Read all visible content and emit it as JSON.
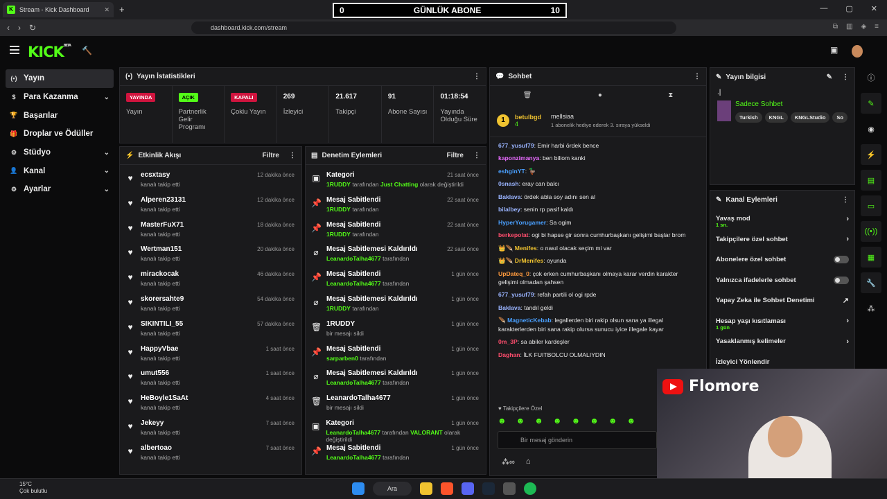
{
  "browser": {
    "tab_title": "Stream - Kick Dashboard",
    "url": "dashboard.kick.com/stream"
  },
  "overlay": {
    "left": "0",
    "title": "GÜNLÜK ABONE",
    "right": "10"
  },
  "sidebar": [
    {
      "label": "Yayın",
      "icon": "broadcast-icon"
    },
    {
      "label": "Para Kazanma",
      "icon": "money-icon",
      "chev": "⌄"
    },
    {
      "label": "Başarılar",
      "icon": "trophy-icon"
    },
    {
      "label": "Droplar ve Ödüller",
      "icon": "gift-icon"
    },
    {
      "label": "Stüdyo",
      "icon": "gear-icon",
      "chev": "⌄"
    },
    {
      "label": "Kanal",
      "icon": "channel-icon",
      "chev": "⌄"
    },
    {
      "label": "Ayarlar",
      "icon": "settings-icon",
      "chev": "⌄"
    }
  ],
  "stats": {
    "title": "Yayın İstatistikleri",
    "items": [
      {
        "badge": "YAYINDA",
        "label": "Yayın"
      },
      {
        "badge": "AÇIK",
        "label": "Partnerlik Gelir Programı"
      },
      {
        "badge": "KAPALI",
        "label": "Çoklu Yayın"
      },
      {
        "value": "269",
        "label": "İzleyici"
      },
      {
        "value": "21.617",
        "label": "Takipçi"
      },
      {
        "value": "91",
        "label": "Abone Sayısı"
      },
      {
        "value": "01:18:54",
        "label": "Yayında Olduğu Süre"
      }
    ]
  },
  "activity": {
    "title": "Etkinlik Akışı",
    "filter": "Filtre",
    "items": [
      {
        "name": "ecsxtasy",
        "sub": "kanalı takip etti",
        "time": "12 dakika önce"
      },
      {
        "name": "Alperen23131",
        "sub": "kanalı takip etti",
        "time": "12 dakika önce"
      },
      {
        "name": "MasterFuX71",
        "sub": "kanalı takip etti",
        "time": "18 dakika önce"
      },
      {
        "name": "Wertman151",
        "sub": "kanalı takip etti",
        "time": "20 dakika önce"
      },
      {
        "name": "mirackocak",
        "sub": "kanalı takip etti",
        "time": "46 dakika önce"
      },
      {
        "name": "skorersahte9",
        "sub": "kanalı takip etti",
        "time": "54 dakika önce"
      },
      {
        "name": "SIKINTILI_55",
        "sub": "kanalı takip etti",
        "time": "57 dakika önce"
      },
      {
        "name": "HappyVbae",
        "sub": "kanalı takip etti",
        "time": "1 saat önce"
      },
      {
        "name": "umut556",
        "sub": "kanalı takip etti",
        "time": "1 saat önce"
      },
      {
        "name": "HeBoyle1SaAt",
        "sub": "kanalı takip etti",
        "time": "4 saat önce"
      },
      {
        "name": "Jekeyy",
        "sub": "kanalı takip etti",
        "time": "7 saat önce"
      },
      {
        "name": "albertoao",
        "sub": "kanalı takip etti",
        "time": "7 saat önce"
      }
    ]
  },
  "mod": {
    "title": "Denetim Eylemleri",
    "filter": "Filtre",
    "items": [
      {
        "icon": "▣",
        "title": "Kategori",
        "sub": "<span class='g'>1RUDDY</span> tarafından <span class='g'>Just Chatting</span> olarak değiştirildi",
        "time": "21 saat önce"
      },
      {
        "icon": "📌",
        "title": "Mesaj Sabitlendi",
        "sub": "<span class='g'>1RUDDY</span> tarafından",
        "time": "22 saat önce"
      },
      {
        "icon": "📌",
        "title": "Mesaj Sabitlendi",
        "sub": "<span class='g'>1RUDDY</span> tarafından",
        "time": "22 saat önce"
      },
      {
        "icon": "⌀",
        "title": "Mesaj Sabitlemesi Kaldırıldı",
        "sub": "<span class='g'>LeanardoTalha4677</span> tarafından",
        "time": "22 saat önce"
      },
      {
        "icon": "📌",
        "title": "Mesaj Sabitlendi",
        "sub": "<span class='g'>LeanardoTalha4677</span> tarafından",
        "time": "1 gün önce"
      },
      {
        "icon": "⌀",
        "title": "Mesaj Sabitlemesi Kaldırıldı",
        "sub": "<span class='g'>1RUDDY</span> tarafından",
        "time": "1 gün önce"
      },
      {
        "icon": "🗑",
        "title": "1RUDDY",
        "sub": "bir mesajı sildi",
        "time": "1 gün önce"
      },
      {
        "icon": "📌",
        "title": "Mesaj Sabitlendi",
        "sub": "<span class='g'>sarparben0</span> tarafından",
        "time": "1 gün önce"
      },
      {
        "icon": "⌀",
        "title": "Mesaj Sabitlemesi Kaldırıldı",
        "sub": "<span class='g'>LeanardoTalha4677</span> tarafından",
        "time": "1 gün önce"
      },
      {
        "icon": "🗑",
        "title": "LeanardoTalha4677",
        "sub": "bir mesajı sildi",
        "time": "1 gün önce"
      },
      {
        "icon": "▣",
        "title": "Kategori",
        "sub": "<span class='g'>LeanardoTalha4677</span> tarafından <span class='g'>VALORANT</span> olarak değiştirildi",
        "time": "1 gün önce"
      },
      {
        "icon": "📌",
        "title": "Mesaj Sabitlendi",
        "sub": "<span class='g'>LeanardoTalha4677</span> tarafından",
        "time": "1 gün önce"
      }
    ]
  },
  "chat": {
    "title": "Sohbet",
    "gifter": "betulbgd",
    "gift_count": "4",
    "recipient": "mellsiaa",
    "gift_note": "1 abonelik hediye ederek 3. sıraya yükseldi",
    "gift_rank": "1",
    "messages": [
      {
        "user": "677_yusuf79",
        "color": "#9ab4ff",
        "text": "Emir harbi ördek bence"
      },
      {
        "user": "kaponzimanya",
        "color": "#e86bff",
        "text": "ben biliom kanki"
      },
      {
        "user": "eshginYT",
        "color": "#4aa0ff",
        "text": "🦆"
      },
      {
        "user": "0snash",
        "color": "#9ab4ff",
        "text": "eray can balcı"
      },
      {
        "user": "Baklava",
        "color": "#9ab4ff",
        "text": "ördek abla soy adını sen al"
      },
      {
        "user": "bilalbey",
        "color": "#9ab4ff",
        "text": "senin rp pasif kaldı"
      },
      {
        "user": "HyperYorugamer",
        "color": "#4aa0ff",
        "text": "Sa ogim"
      },
      {
        "user": "berkepolat",
        "color": "#ff4d6d",
        "text": "ogi bi hapse gir sonra cumhurbaşkanı gelişimi başlar brom"
      },
      {
        "user": "👑🪶 Menifes",
        "color": "#f0c330",
        "text": "o nasıl olacak seçim mi var"
      },
      {
        "user": "👑🪶 DrMenifes",
        "color": "#f0c330",
        "text": "oyunda"
      },
      {
        "user": "UpDateq_0",
        "color": "#ff9a3d",
        "text": "çok erken cumhurbaşkanı olmaya karar verdin karakter gelişimi olmadan şahsen"
      },
      {
        "user": "677_yusuf79",
        "color": "#9ab4ff",
        "text": "refah partili ol ogi rpde"
      },
      {
        "user": "Baklava",
        "color": "#9ab4ff",
        "text": "tandıl geldi"
      },
      {
        "user": "🪶 MagneticKebab",
        "color": "#4aa0ff",
        "text": "legallerden biri rakip olsun sana ya illegal karakterlerden biri sana rakip olursa sunucu iyice illegale kayar"
      },
      {
        "user": "0m_3P",
        "color": "#ff4d6d",
        "text": "sa abiler kardeşler"
      },
      {
        "user": "Daghan",
        "color": "#ff4d6d",
        "text": "İLK FUITBOLCU OLMALIYDIN"
      }
    ],
    "followers_only": "Takipçilere Özel",
    "input_placeholder": "Bir mesaj gönderin"
  },
  "streaminfo": {
    "title": "Yayın bilgisi",
    "stream_title": ".|",
    "category": "Sadece Sohbet",
    "tags": [
      "Turkish",
      "KNGL",
      "KNGLStudio",
      "So"
    ]
  },
  "channel_actions": {
    "title": "Kanal Eylemleri",
    "items": [
      {
        "label": "Yavaş mod",
        "sub": "1 sn.",
        "type": "arrow"
      },
      {
        "label": "Takipçilere özel sohbet",
        "type": "arrow"
      },
      {
        "label": "Abonelere özel sohbet",
        "type": "toggle"
      },
      {
        "label": "Yalnızca ifadelerle sohbet",
        "type": "toggle"
      },
      {
        "label": "Yapay Zeka ile Sohbet Denetimi",
        "type": "ext"
      },
      {
        "label": "Hesap yaşı kısıtlaması",
        "sub": "1 gün",
        "type": "arrow"
      },
      {
        "label": "Yasaklanmış kelimeler",
        "type": "arrow"
      },
      {
        "label": "İzleyici Yönlendir",
        "type": "none"
      }
    ]
  },
  "webcam": {
    "channel_name": "Flomore"
  },
  "taskbar": {
    "temp": "15°C",
    "weather": "Çok bulutlu",
    "search": "Ara"
  }
}
